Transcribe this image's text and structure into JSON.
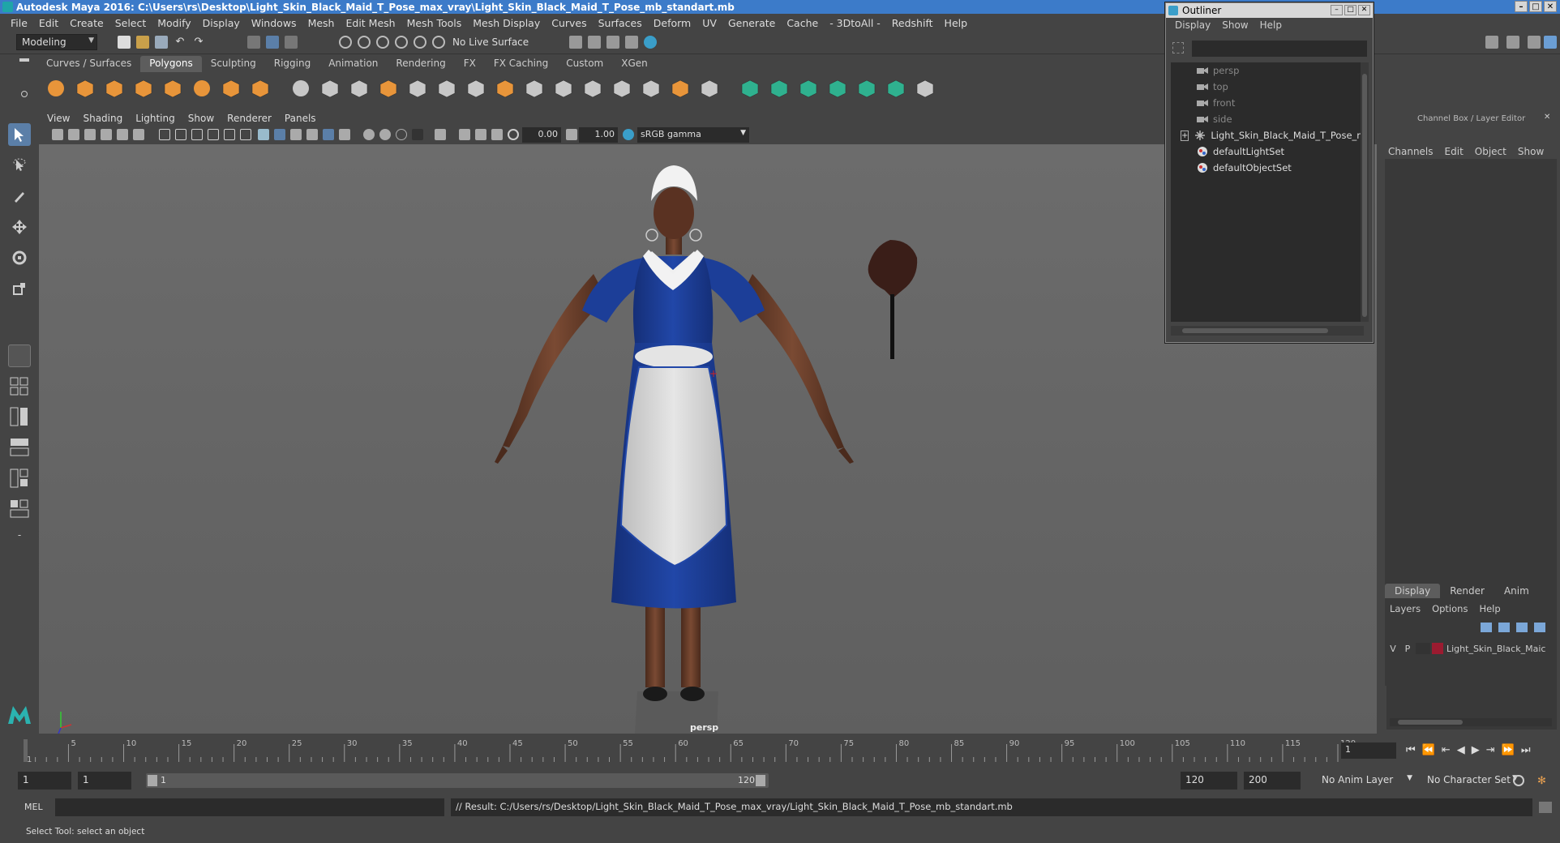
{
  "titlebar": {
    "title": "Autodesk Maya 2016: C:\\Users\\rs\\Desktop\\Light_Skin_Black_Maid_T_Pose_max_vray\\Light_Skin_Black_Maid_T_Pose_mb_standart.mb"
  },
  "menubar": [
    "File",
    "Edit",
    "Create",
    "Select",
    "Modify",
    "Display",
    "Windows",
    "Mesh",
    "Edit Mesh",
    "Mesh Tools",
    "Mesh Display",
    "Curves",
    "Surfaces",
    "Deform",
    "UV",
    "Generate",
    "Cache",
    "- 3DtoAll -",
    "Redshift",
    "Help"
  ],
  "status": {
    "mode": "Modeling",
    "live_surface": "No Live Surface"
  },
  "shelf_tabs": [
    "Curves / Surfaces",
    "Polygons",
    "Sculpting",
    "Rigging",
    "Animation",
    "Rendering",
    "FX",
    "FX Caching",
    "Custom",
    "XGen"
  ],
  "shelf_active": "Polygons",
  "viewport": {
    "menus": [
      "View",
      "Shading",
      "Lighting",
      "Show",
      "Renderer",
      "Panels"
    ],
    "exposure": "0.00",
    "gamma": "1.00",
    "colorspace": "sRGB gamma",
    "camera_label": "persp"
  },
  "outliner": {
    "title": "Outliner",
    "menus": [
      "Display",
      "Show",
      "Help"
    ],
    "items": [
      {
        "label": "persp",
        "dim": true,
        "icon": "camera-icon"
      },
      {
        "label": "top",
        "dim": true,
        "icon": "camera-icon"
      },
      {
        "label": "front",
        "dim": true,
        "icon": "camera-icon"
      },
      {
        "label": "side",
        "dim": true,
        "icon": "camera-icon"
      },
      {
        "label": "Light_Skin_Black_Maid_T_Pose_nc",
        "dim": false,
        "icon": "group-icon"
      },
      {
        "label": "defaultLightSet",
        "dim": false,
        "icon": "set-icon"
      },
      {
        "label": "defaultObjectSet",
        "dim": false,
        "icon": "set-icon"
      }
    ]
  },
  "channelbox": {
    "title": "Channel Box / Layer Editor",
    "menus": [
      "Channels",
      "Edit",
      "Object",
      "Show"
    ],
    "layer_tabs": [
      "Display",
      "Render",
      "Anim"
    ],
    "layer_menus": [
      "Layers",
      "Options",
      "Help"
    ],
    "layer": {
      "v": "V",
      "p": "P",
      "name": "Light_Skin_Black_Maic",
      "color": "#9b1b30"
    }
  },
  "timeline": {
    "ticks": [
      "1",
      "5",
      "10",
      "15",
      "20",
      "25",
      "30",
      "35",
      "40",
      "45",
      "50",
      "55",
      "60",
      "65",
      "70",
      "75",
      "80",
      "85",
      "90",
      "95",
      "100",
      "105",
      "110",
      "115",
      "120"
    ],
    "current_frame": "1"
  },
  "range": {
    "start": "1",
    "start2": "1",
    "slider_start": "1",
    "slider_end": "120",
    "end": "120",
    "end2": "200",
    "anim_layer": "No Anim Layer",
    "char_set": "No Character Set"
  },
  "cmdline": {
    "lang": "MEL",
    "result": "// Result: C:/Users/rs/Desktop/Light_Skin_Black_Maid_T_Pose_max_vray/Light_Skin_Black_Maid_T_Pose_mb_standart.mb"
  },
  "helpline": {
    "text": "Select Tool: select an object"
  }
}
